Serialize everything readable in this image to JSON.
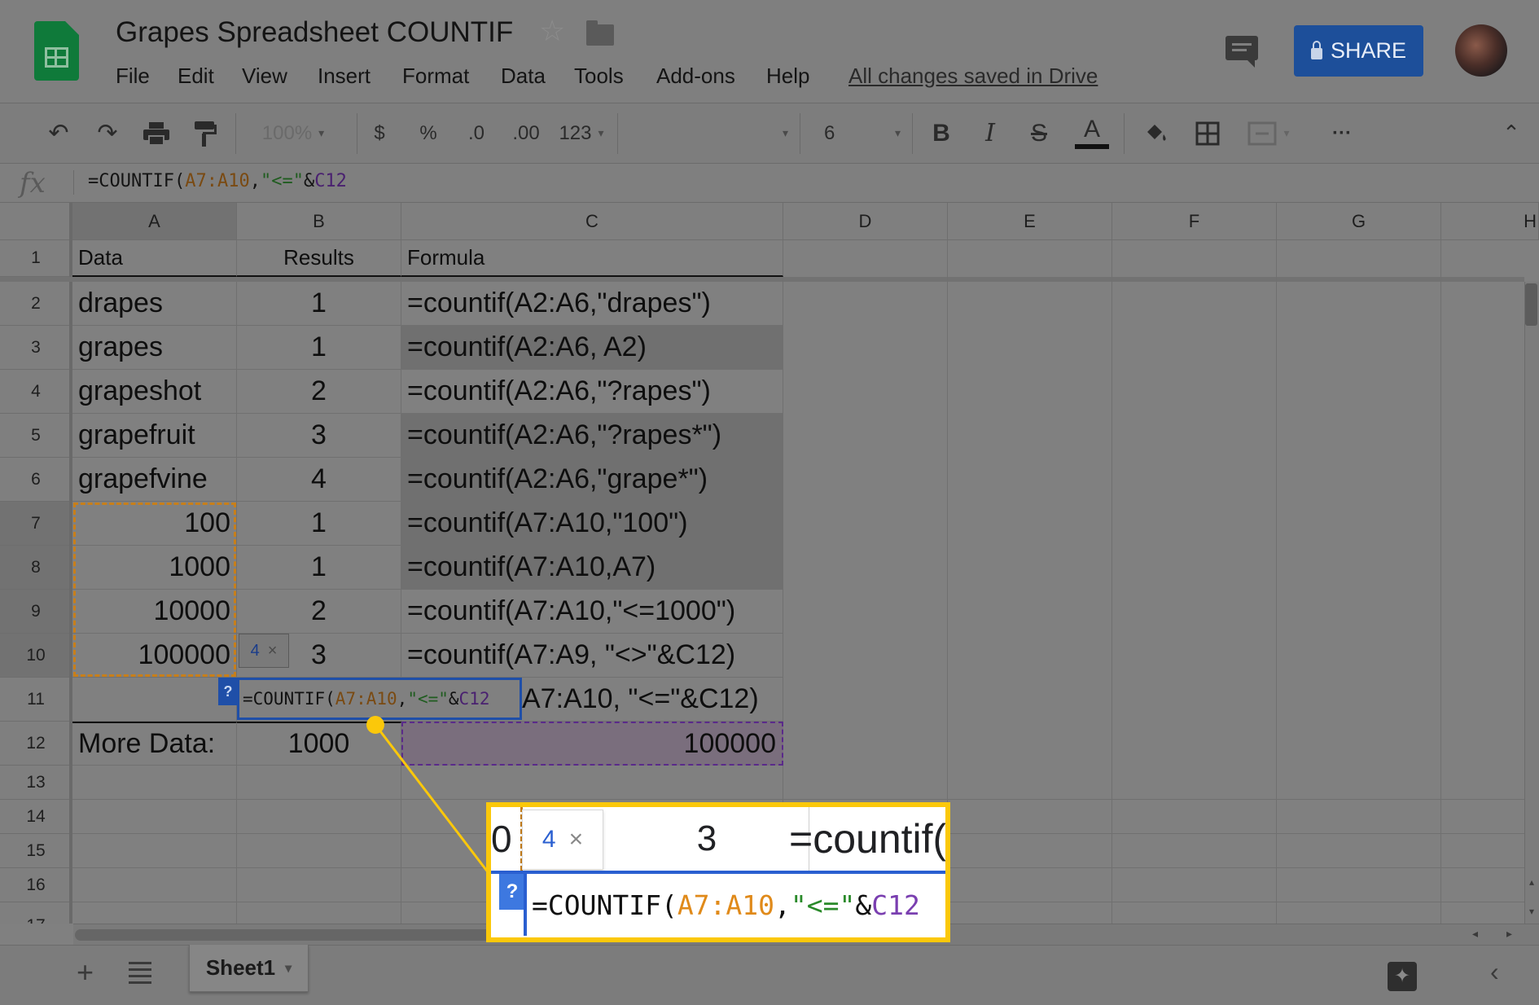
{
  "app": {
    "title": "Grapes Spreadsheet COUNTIF",
    "save_status": "All changes saved in Drive",
    "share_label": "SHARE",
    "menu": [
      "File",
      "Edit",
      "View",
      "Insert",
      "Format",
      "Data",
      "Tools",
      "Add-ons",
      "Help"
    ]
  },
  "toolbar": {
    "zoom": "100%",
    "currency": "$",
    "percent": "%",
    "decrease_decimal": ".0",
    "increase_decimal": ".00",
    "more_formats": "123",
    "font": "",
    "font_size": "6",
    "bold": "B",
    "italic": "I",
    "strikethrough": "S",
    "text_color": "A",
    "more": "···"
  },
  "formula_bar": {
    "fx": "fx",
    "parts": [
      "=COUNTIF(",
      "A7:A10",
      ",",
      "\"<=\"",
      "&",
      "C12"
    ]
  },
  "columns": [
    "A",
    "B",
    "C",
    "D",
    "E",
    "F",
    "G",
    "H"
  ],
  "rows": [
    "1",
    "2",
    "3",
    "4",
    "5",
    "6",
    "7",
    "8",
    "9",
    "10",
    "11",
    "12",
    "13",
    "14",
    "15",
    "16",
    "17"
  ],
  "cells": {
    "A1": "Data",
    "B1": "Results",
    "C1": "Formula",
    "A2": "drapes",
    "B2": "1",
    "C2": "=countif(A2:A6,\"drapes\")",
    "A3": "grapes",
    "B3": "1",
    "C3": "=countif(A2:A6, A2)",
    "A4": "grapeshot",
    "B4": "2",
    "C4": "=countif(A2:A6,\"?rapes\")",
    "A5": "grapefruit",
    "B5": "3",
    "C5": "=countif(A2:A6,\"?rapes*\")",
    "A6": "grapefvine",
    "B6": "4",
    "C6": "=countif(A2:A6,\"grape*\")",
    "A7": "100",
    "B7": "1",
    "C7": "=countif(A7:A10,\"100\")",
    "A8": "1000",
    "B8": "1",
    "C8": "=countif(A7:A10,A7)",
    "A9": "10000",
    "B9": "2",
    "C9": "=countif(A7:A10,\"<=1000\")",
    "A10": "100000",
    "B10": "3",
    "C10": "=countif(A7:A9, \"<>\"&C12)",
    "C11": "A7:A10, \"<=\"&C12)",
    "A12": "More Data:",
    "B12": "1000",
    "C12": "100000"
  },
  "editor": {
    "hint_value": "4",
    "hint_close": "×",
    "help": "?"
  },
  "zoom_callout": {
    "cell_left": "0",
    "hint_value": "4",
    "hint_close": "×",
    "result": "3",
    "formula_fragment": "=countif(",
    "help": "?"
  },
  "sheets": [
    "Sheet1"
  ],
  "colors": {
    "range_highlight": "#c87f1a",
    "criteria_highlight": "#6a2f9a",
    "editor_border": "#1f4fa8",
    "callout_border": "#fbc80a",
    "share_button": "#1d4f9a"
  }
}
